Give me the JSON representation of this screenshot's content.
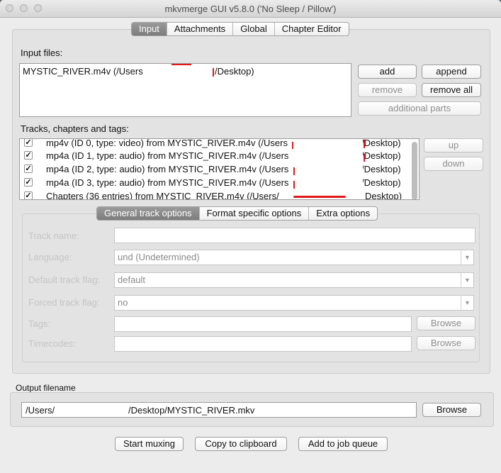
{
  "window": {
    "title": "mkvmerge GUI v5.8.0 ('No Sleep / Pillow')"
  },
  "main_tabs": [
    {
      "label": "Input",
      "selected": true
    },
    {
      "label": "Attachments",
      "selected": false
    },
    {
      "label": "Global",
      "selected": false
    },
    {
      "label": "Chapter Editor",
      "selected": false
    }
  ],
  "input_files": {
    "label": "Input files:",
    "items": [
      {
        "name": "MYSTIC_RIVER.m4v (/Users",
        "path_end": "/Desktop)"
      }
    ],
    "buttons": {
      "add": "add",
      "append": "append",
      "remove": "remove",
      "remove_all": "remove all",
      "additional_parts": "additional parts"
    }
  },
  "tracks": {
    "label": "Tracks, chapters and tags:",
    "items": [
      {
        "text": "mp4v (ID 0, type: video) from MYSTIC_RIVER.m4v (/Users",
        "path_end": "/Desktop)",
        "checked": true
      },
      {
        "text": "mp4a (ID 1, type: audio) from MYSTIC_RIVER.m4v (/Users",
        "path_end": "/Desktop)",
        "checked": true
      },
      {
        "text": "mp4a (ID 2, type: audio) from MYSTIC_RIVER.m4v (/Users",
        "path_end": "/Desktop)",
        "checked": true
      },
      {
        "text": "mp4a (ID 3, type: audio) from MYSTIC_RIVER.m4v (/Users",
        "path_end": "/Desktop)",
        "checked": true
      },
      {
        "text": "Chapters (36 entries) from MYSTIC_RIVER.m4v (/Users/",
        "path_end": "Desktop)",
        "checked": true
      }
    ],
    "buttons": {
      "up": "up",
      "down": "down"
    }
  },
  "option_tabs": [
    {
      "label": "General track options",
      "selected": true
    },
    {
      "label": "Format specific options",
      "selected": false
    },
    {
      "label": "Extra options",
      "selected": false
    }
  ],
  "track_options": {
    "track_name_label": "Track name:",
    "track_name_value": "",
    "language_label": "Language:",
    "language_value": "und (Undetermined)",
    "default_flag_label": "Default track flag:",
    "default_flag_value": "default",
    "forced_flag_label": "Forced track flag:",
    "forced_flag_value": "no",
    "tags_label": "Tags:",
    "tags_value": "",
    "timecodes_label": "Timecodes:",
    "timecodes_value": "",
    "browse_label": "Browse"
  },
  "output": {
    "label": "Output filename",
    "value_start": "/Users/",
    "value_end": "/Desktop/MYSTIC_RIVER.mkv",
    "browse_label": "Browse"
  },
  "actions": {
    "start_muxing": "Start muxing",
    "copy_clipboard": "Copy to clipboard",
    "add_job_queue": "Add to job queue"
  },
  "colors": {
    "redaction_mark": "#e01818",
    "selected_tab": "#8a8a8a"
  }
}
